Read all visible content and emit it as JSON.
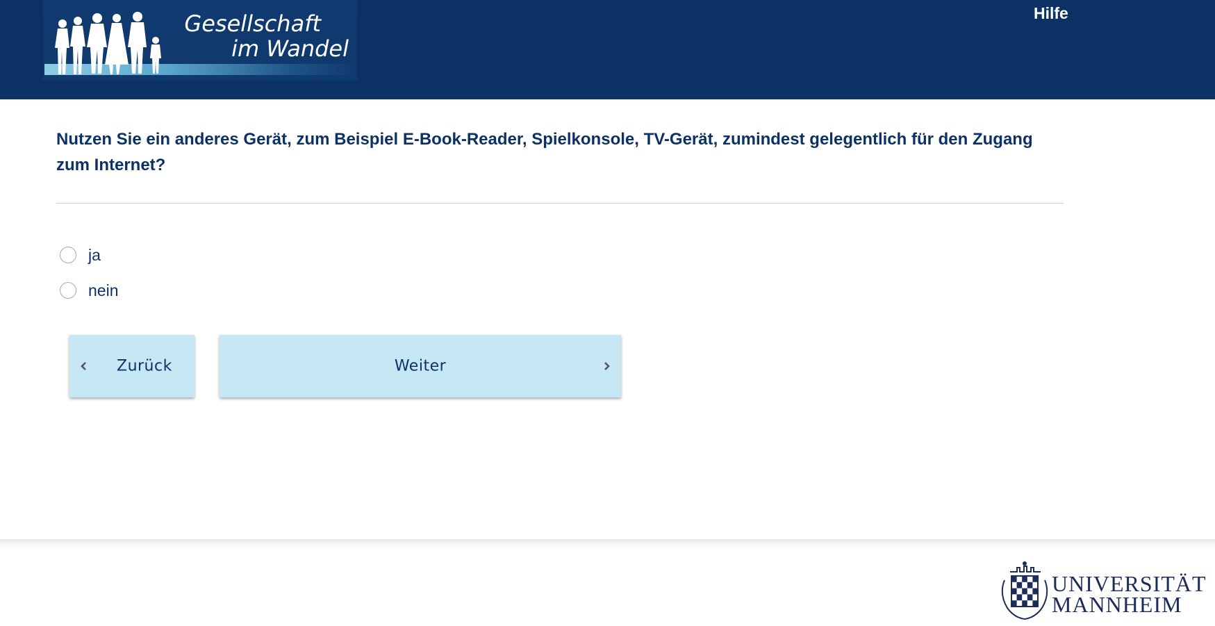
{
  "header": {
    "logo_line1": "Gesellschaft",
    "logo_line2": "im Wandel",
    "help_label": "Hilfe",
    "background_color": "#0c3265"
  },
  "question": {
    "text": "Nutzen Sie ein anderes Gerät, zum Beispiel E-Book-Reader, Spielkonsole, TV-Gerät, zumindest gelegentlich für den Zugang zum Internet?"
  },
  "options": [
    {
      "label": "ja",
      "selected": false
    },
    {
      "label": "nein",
      "selected": false
    }
  ],
  "navigation": {
    "back_label": "Zurück",
    "next_label": "Weiter",
    "button_color": "#c6e8f4"
  },
  "footer": {
    "university_line1": "UNIVERSITÄT",
    "university_line2": "MANNHEIM"
  },
  "icons": {
    "logo_people": "people-silhouette-icon",
    "back": "chevron-left-icon",
    "next": "chevron-right-icon",
    "crest": "university-crest-icon"
  }
}
